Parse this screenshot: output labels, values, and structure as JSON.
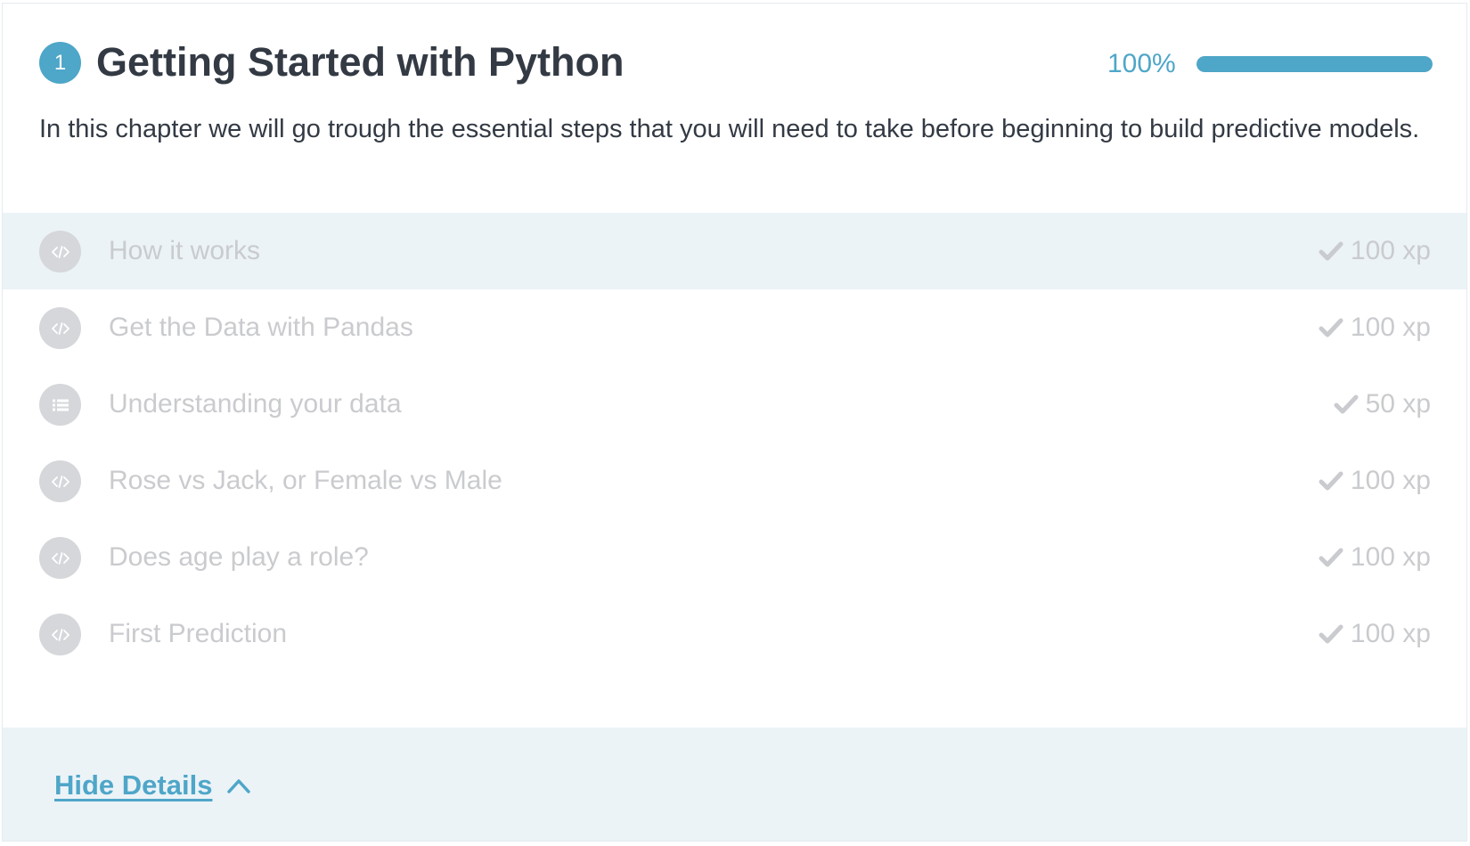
{
  "chapter": {
    "number": "1",
    "title": "Getting Started with Python",
    "progress_label": "100%",
    "progress_fraction": 1.0,
    "description": "In this chapter we will go trough the essential steps that you will need to take before beginning to build predictive models."
  },
  "exercises": [
    {
      "title": "How it works",
      "xp": "100 xp",
      "icon": "code-icon",
      "active": true
    },
    {
      "title": "Get the Data with Pandas",
      "xp": "100 xp",
      "icon": "code-icon",
      "active": false
    },
    {
      "title": "Understanding your data",
      "xp": "50 xp",
      "icon": "list-icon",
      "active": false
    },
    {
      "title": "Rose vs Jack, or Female vs Male",
      "xp": "100 xp",
      "icon": "code-icon",
      "active": false
    },
    {
      "title": "Does age play a role?",
      "xp": "100 xp",
      "icon": "code-icon",
      "active": false
    },
    {
      "title": "First Prediction",
      "xp": "100 xp",
      "icon": "code-icon",
      "active": false
    }
  ],
  "footer": {
    "toggle_label": "Hide Details"
  },
  "colors": {
    "accent": "#4ea6c8",
    "title_text": "#333a44",
    "muted_text": "#c9cbce",
    "row_highlight": "#ebf3f7"
  }
}
